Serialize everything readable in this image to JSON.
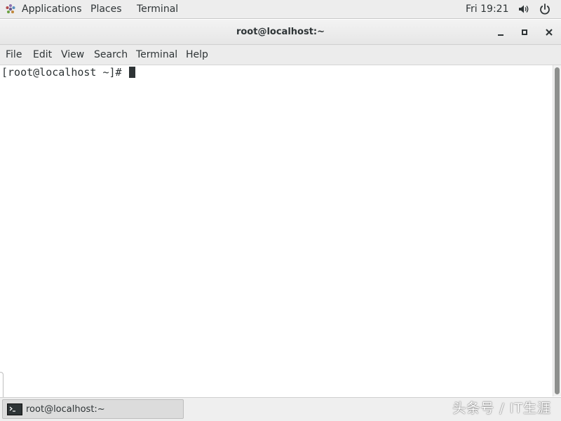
{
  "topbar": {
    "applications": "Applications",
    "places": "Places",
    "terminal": "Terminal",
    "clock": "Fri 19:21",
    "icons": [
      "applications-icon",
      "volume-icon",
      "power-icon"
    ]
  },
  "window": {
    "title": "root@localhost:~",
    "controls": [
      "minimize-icon",
      "maximize-icon",
      "close-icon"
    ]
  },
  "menu": {
    "items": [
      "File",
      "Edit",
      "View",
      "Search",
      "Terminal",
      "Help"
    ]
  },
  "terminal": {
    "prompt": "[root@localhost ~]# "
  },
  "taskbar": {
    "task_label": "root@localhost:~",
    "task_icon": "terminal-icon"
  },
  "watermark": "头条号 / IT生涯",
  "colors": {
    "topbar_bg": "#ededed",
    "header_bg": "#e9e9e9",
    "terminal_bg": "#ffffff",
    "text": "#2e3436"
  }
}
